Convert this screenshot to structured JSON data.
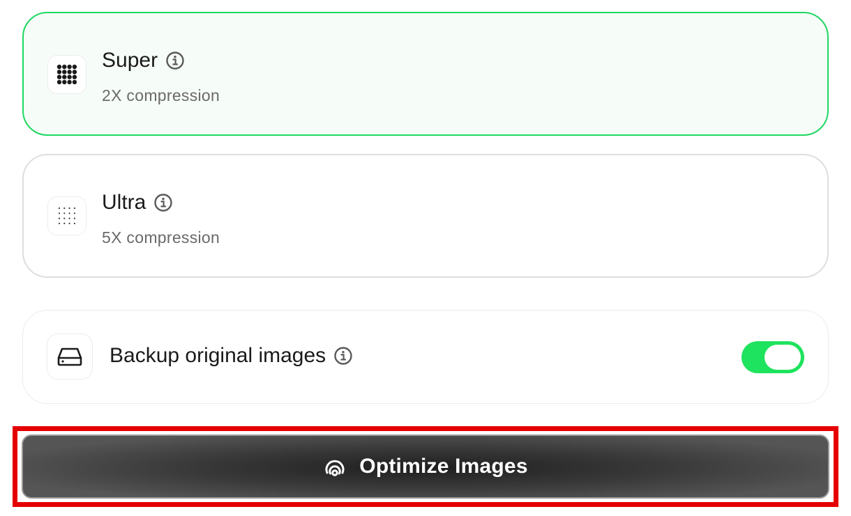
{
  "levels": [
    {
      "title": "Super",
      "subtitle": "2X compression",
      "icon": "dense-dots-grid-icon",
      "selected": true
    },
    {
      "title": "Ultra",
      "subtitle": "5X compression",
      "icon": "sparse-dots-grid-icon",
      "selected": false
    }
  ],
  "backup": {
    "label": "Backup original images",
    "icon": "hard-drive-icon",
    "enabled": true
  },
  "action": {
    "label": "Optimize Images",
    "icon": "optimize-icon"
  },
  "colors": {
    "accent": "#1ed760",
    "toggle_on": "#1ee35e",
    "selected_bg": "#f6fcf8",
    "button_dark": "#2a2a2a",
    "highlight": "#e50000"
  }
}
